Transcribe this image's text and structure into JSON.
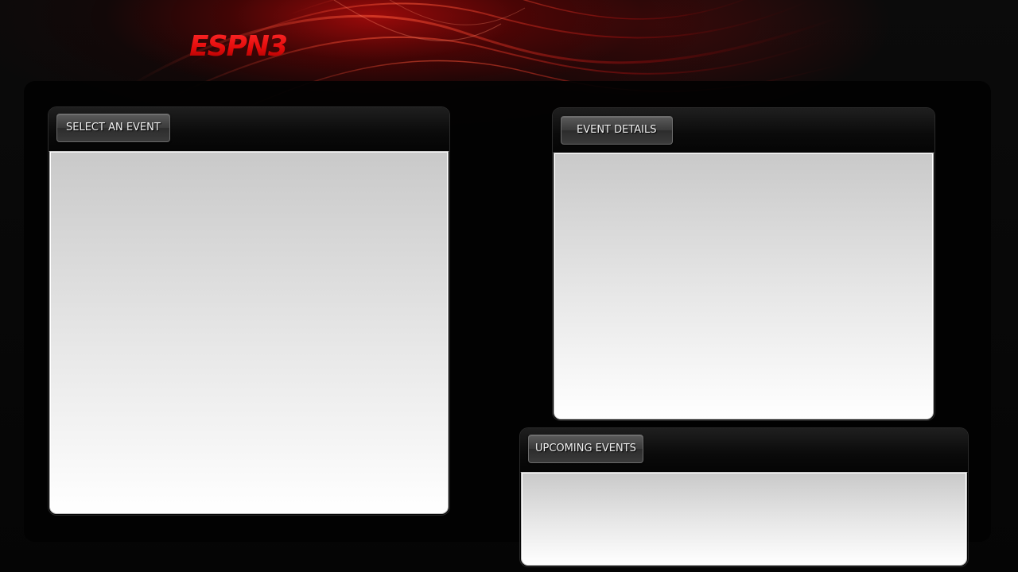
{
  "header": {
    "logo_text": "ESPN3",
    "logo_color": "#e30b0b"
  },
  "panels": {
    "select_event": {
      "title": "SELECT AN EVENT"
    },
    "event_details": {
      "title": "EVENT DETAILS"
    },
    "upcoming_events": {
      "title": "UPCOMING EVENTS"
    }
  },
  "colors": {
    "background": "#080808",
    "accent_red": "#b40a0a",
    "panel_body_top": "#c9c9c9",
    "panel_body_bottom": "#ffffff"
  }
}
